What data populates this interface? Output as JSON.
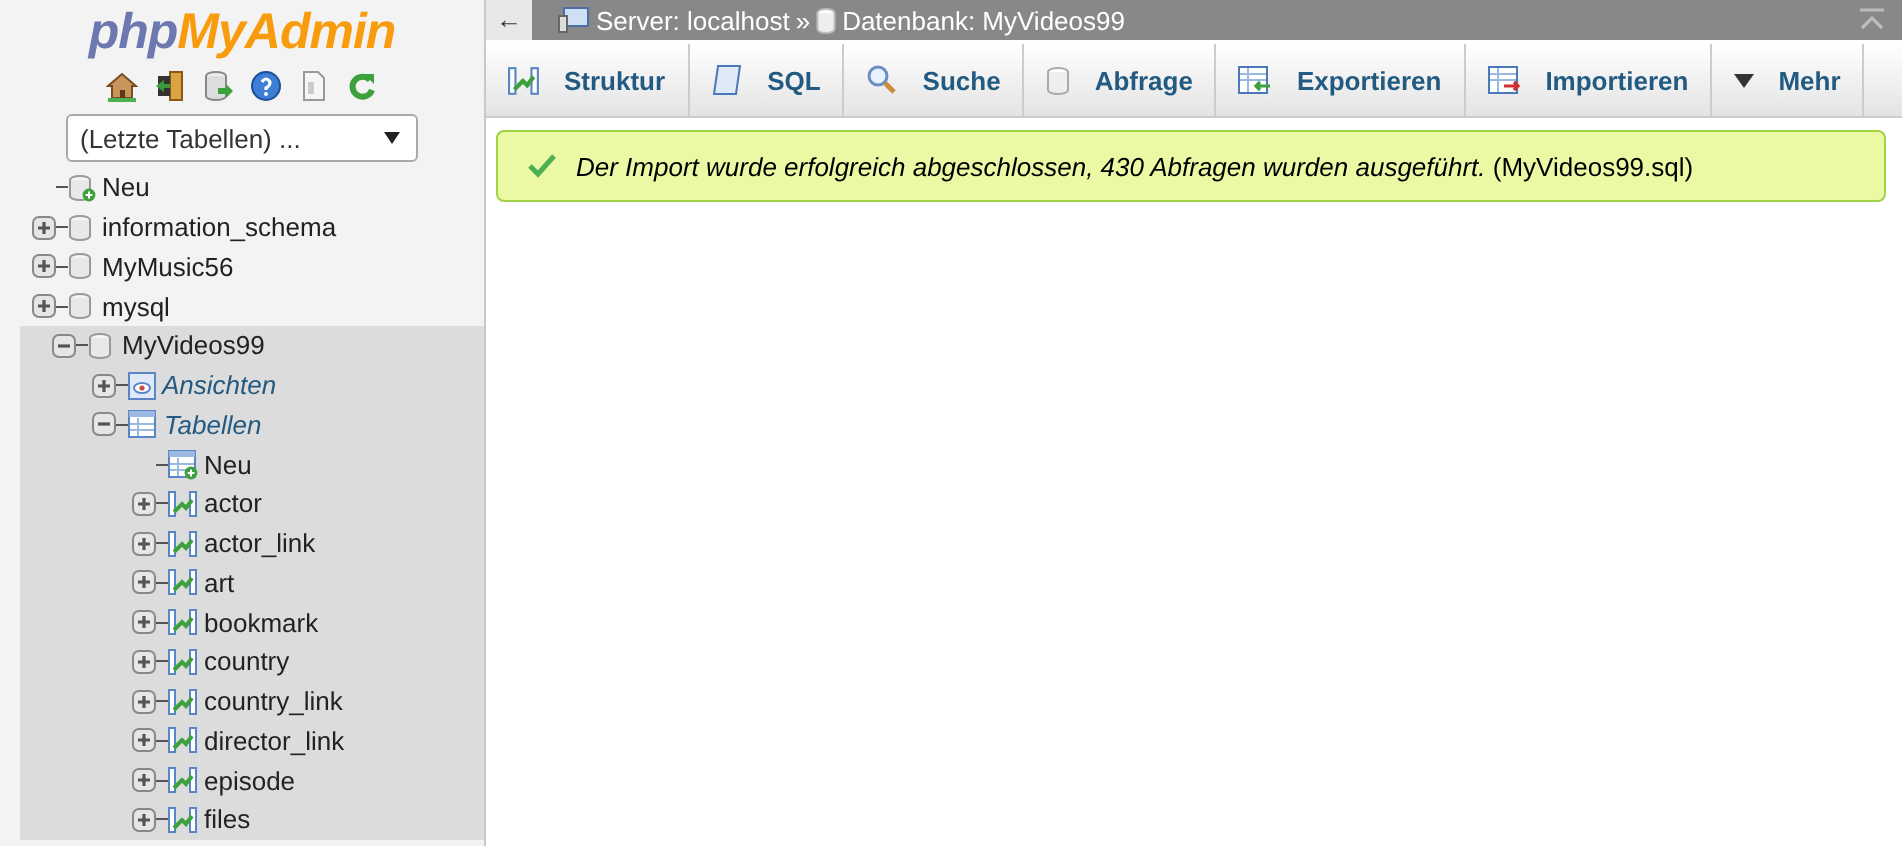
{
  "logo": {
    "prefix": "php",
    "name": "MyAdmin"
  },
  "recent_tables": {
    "value": "(Letzte Tabellen) ..."
  },
  "tree": [
    {
      "label": "Neu",
      "kind": "new"
    },
    {
      "label": "information_schema",
      "kind": "db",
      "expanded": false,
      "selected": false
    },
    {
      "label": "MyMusic56",
      "kind": "db",
      "expanded": false,
      "selected": false
    },
    {
      "label": "mysql",
      "kind": "db",
      "expanded": false,
      "selected": false
    },
    {
      "label": "MyVideos99",
      "kind": "db",
      "expanded": true,
      "selected": true,
      "children": [
        {
          "label": "Ansichten",
          "kind": "views",
          "expanded": false
        },
        {
          "label": "Tabellen",
          "kind": "tables",
          "expanded": true,
          "children": [
            {
              "label": "Neu",
              "kind": "newtable"
            },
            {
              "label": "actor",
              "kind": "table",
              "expanded": false
            },
            {
              "label": "actor_link",
              "kind": "table",
              "expanded": false
            },
            {
              "label": "art",
              "kind": "table",
              "expanded": false
            },
            {
              "label": "bookmark",
              "kind": "table",
              "expanded": false
            },
            {
              "label": "country",
              "kind": "table",
              "expanded": false
            },
            {
              "label": "country_link",
              "kind": "table",
              "expanded": false
            },
            {
              "label": "director_link",
              "kind": "table",
              "expanded": false
            },
            {
              "label": "episode",
              "kind": "table",
              "expanded": false
            },
            {
              "label": "files",
              "kind": "table",
              "expanded": false
            }
          ]
        }
      ]
    }
  ],
  "topbar": {
    "back": "←",
    "breadcrumb": [
      {
        "label": "Server: localhost",
        "kind": "server"
      },
      {
        "label": "»",
        "kind": "separator"
      },
      {
        "label": "Datenbank: MyVideos99",
        "kind": "database"
      }
    ]
  },
  "tabs": [
    {
      "label": "Struktur",
      "kind": "structure"
    },
    {
      "label": "SQL",
      "kind": "sql"
    },
    {
      "label": "Suche",
      "kind": "search"
    },
    {
      "label": "Abfrage",
      "kind": "query"
    },
    {
      "label": "Exportieren",
      "kind": "export"
    },
    {
      "label": "Importieren",
      "kind": "import"
    },
    {
      "label": "Mehr",
      "kind": "more"
    }
  ],
  "message": {
    "kind": "success",
    "text": "*Der Import wurde erfolgreich abgeschlossen, 430 Abfragen wurden ausgeführt.* (MyVideos99.sql)"
  }
}
